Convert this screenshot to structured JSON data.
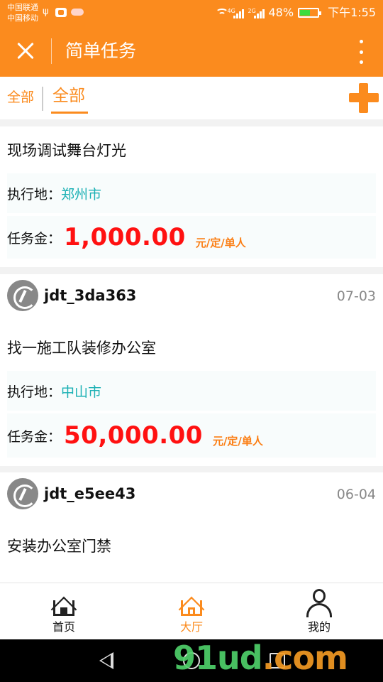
{
  "status_bar": {
    "carrier_1": "中国联通",
    "carrier_2": "中国移动",
    "net_1": "4G",
    "net_2": "2G",
    "battery": "48%",
    "time": "下午1:55"
  },
  "header": {
    "title": "简单任务"
  },
  "tabs": {
    "left_label": "全部",
    "active_label": "全部"
  },
  "tasks": [
    {
      "title": "现场调试舞台灯光",
      "location_label": "执行地：",
      "location": "郑州市",
      "reward_label": "任务金：",
      "amount": "1,000.00",
      "unit": "元/定/单人"
    },
    {
      "user": "jdt_3da363",
      "date": "07-03",
      "title": "找一施工队装修办公室",
      "location_label": "执行地：",
      "location": "中山市",
      "reward_label": "任务金：",
      "amount": "50,000.00",
      "unit": "元/定/单人"
    },
    {
      "user": "jdt_e5ee43",
      "date": "06-04",
      "title": "安装办公室门禁"
    }
  ],
  "bottom_nav": [
    {
      "label": "首页",
      "active": false
    },
    {
      "label": "大厅",
      "active": true
    },
    {
      "label": "我的",
      "active": false
    }
  ],
  "watermark": {
    "main": "91ud",
    "suffix": ".com"
  },
  "colors": {
    "brand_orange": "#fb8b1e",
    "amount_red": "#f11111",
    "city_teal": "#1ab0b4"
  }
}
